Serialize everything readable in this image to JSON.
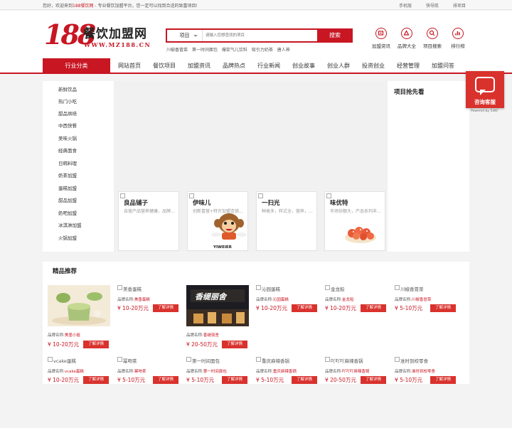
{
  "topbar": {
    "welcome_prefix": "您好，欢迎来到",
    "welcome_site": "188餐饮网",
    "welcome_suffix": " - 专业餐饮加盟平台，您一定可以找到合适的致富项目!",
    "links": [
      "手机版",
      "快导航",
      "排项目"
    ]
  },
  "logo": {
    "number": "188",
    "name": "餐饮加盟网",
    "url": "WWW.MZ188.CN"
  },
  "search": {
    "category": "项目",
    "placeholder": "请输入您想查找的项目",
    "button": "搜索",
    "hot_keywords": [
      "川椒香冒菜",
      "第一时间面包",
      "爆浆气儿饮料",
      "吸引力奶茶",
      "唐人神"
    ]
  },
  "header_icons": [
    {
      "label": "加盟资讯",
      "icon": "news-icon"
    },
    {
      "label": "品牌大全",
      "icon": "brand-icon"
    },
    {
      "label": "项目搜索",
      "icon": "search-icon"
    },
    {
      "label": "排行榜",
      "icon": "ranking-icon"
    }
  ],
  "nav": {
    "category_label": "行业分类",
    "items": [
      "网站首页",
      "餐饮项目",
      "加盟资讯",
      "品牌热点",
      "行业新闻",
      "创业故事",
      "创业人群",
      "投资创业",
      "经营管理",
      "加盟问答"
    ]
  },
  "categories": [
    "新鲜饮品",
    "热门小吃",
    "甜品烘焙",
    "中西快餐",
    "美味火锅",
    "经典面食",
    "日韩料理",
    "奶茶加盟",
    "蛋糕加盟",
    "甜品加盟",
    "奶吧加盟",
    "冰淇淋加盟",
    "火锅加盟"
  ],
  "banner_cards": [
    {
      "title": "良品铺子",
      "desc": "自营产品营养健康，品牌..."
    },
    {
      "title": "伊味儿",
      "desc": "创新喜营+特许加盟连锁..."
    },
    {
      "title": "一扫光",
      "desc": "种类多，样式全，营养，..."
    },
    {
      "title": "味优特",
      "desc": "市场份额大，产品系列丰..."
    }
  ],
  "mascot_text": "YIWEIER",
  "project_panel": {
    "title": "项目抢先看"
  },
  "consult": {
    "label": "咨询客服",
    "powered": "Powered by 53KF"
  },
  "featured": {
    "title": "精品推荐",
    "brand_label": "品牌名称:",
    "more_label": "了解详情",
    "row1": [
      {
        "brand": "美墨小姐",
        "price": "¥ 10-20万元",
        "image": true
      },
      {
        "brand": "美香蛋糕",
        "price": "¥ 10-20万元",
        "alt": "美香蛋糕",
        "image": false
      },
      {
        "brand": "香缇丽舍",
        "price": "¥ 20-50万元",
        "image": true,
        "sign": "香缇丽舍"
      },
      {
        "brand": "沁园蛋糕",
        "price": "¥ 10-20万元",
        "alt": "沁园蛋糕",
        "image": false
      },
      {
        "brand": "金龙船",
        "price": "¥ 10-20万元",
        "alt": "金龙船",
        "image": false
      },
      {
        "brand": "川椒香冒菜",
        "price": "¥ 5-10万元",
        "alt": "川椒香冒菜",
        "image": false
      }
    ],
    "row2": [
      {
        "brand": "vcake蛋糕",
        "price": "¥ 10-20万元",
        "alt": "vcake蛋糕"
      },
      {
        "brand": "幂吻茶",
        "price": "¥ 5-10万元",
        "alt": "幂吻茶"
      },
      {
        "brand": "第一时间面包",
        "price": "¥ 5-10万元",
        "alt": "第一时间面包"
      },
      {
        "brand": "重庆麻辣香锅",
        "price": "¥ 5-10万元",
        "alt": "重庆麻辣香锅"
      },
      {
        "brand": "吖吖吖麻辣香锅",
        "price": "¥ 20-50万元",
        "alt": "吖吖吖麻辣香锅"
      },
      {
        "brand": "准时到校零食",
        "price": "¥ 5-10万元",
        "alt": "准时到校零食"
      }
    ]
  }
}
